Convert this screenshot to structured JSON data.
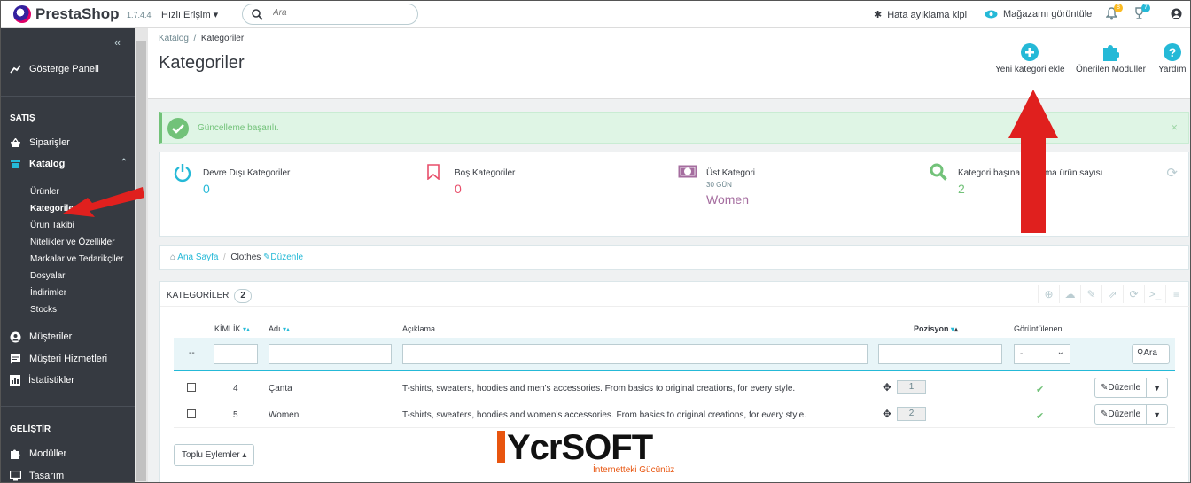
{
  "header": {
    "logo": "PrestaShop",
    "version": "1.7.4.4",
    "quick_access": "Hızlı Erişim",
    "search_placeholder": "Ara",
    "debug_mode": "Hata ayıklama kipi",
    "view_shop": "Mağazamı görüntüle",
    "notifications_count": "8",
    "trophy_count": "7"
  },
  "sidebar": {
    "dashboard": "Gösterge Paneli",
    "section_sell": "SATIŞ",
    "orders": "Siparişler",
    "catalog": "Katalog",
    "catalog_sub": [
      "Ürünler",
      "Kategoriler",
      "Ürün Takibi",
      "Nitelikler ve Özellikler",
      "Markalar ve Tedarikçiler",
      "Dosyalar",
      "İndirimler",
      "Stocks"
    ],
    "customers": "Müşteriler",
    "customer_service": "Müşteri Hizmetleri",
    "stats": "İstatistikler",
    "section_dev": "GELİŞTİR",
    "modules": "Modüller",
    "design": "Tasarım"
  },
  "page": {
    "breadcrumb_parent": "Katalog",
    "breadcrumb_sep": "/",
    "breadcrumb_current": "Kategoriler",
    "title": "Kategoriler",
    "toolbar": {
      "add": "Yeni kategori ekle",
      "modules": "Önerilen Modüller",
      "help": "Yardım"
    }
  },
  "alert": {
    "message": "Güncelleme başarılı.",
    "close": "×"
  },
  "kpis": [
    {
      "title": "Devre Dışı Kategoriler",
      "value": "0",
      "color": "#25b9d7"
    },
    {
      "title": "Boş Kategoriler",
      "value": "0",
      "color": "#e84e6a"
    },
    {
      "title": "Üst Kategori",
      "sub": "30 GÜN",
      "value": "Women",
      "color": "#a56d9f"
    },
    {
      "title": "Kategori başına ortalama ürün sayısı",
      "value": "2",
      "color": "#72c279"
    }
  ],
  "location": {
    "home": "Ana Sayfa",
    "sep": "/",
    "current": "Clothes",
    "edit": "Düzenle"
  },
  "table": {
    "title": "KATEGORİLER",
    "count": "2",
    "headers": {
      "id": "KİMLİK",
      "name": "Adı",
      "desc": "Açıklama",
      "position": "Pozisyon",
      "displayed": "Görüntülenen"
    },
    "filter_dash": "--",
    "filter_select": "-",
    "search_button": "Ara",
    "rows": [
      {
        "id": "4",
        "name": "Çanta",
        "desc": "T-shirts, sweaters, hoodies and men's accessories. From basics to original creations, for every style.",
        "position": "1",
        "edit": "Düzenle"
      },
      {
        "id": "5",
        "name": "Women",
        "desc": "T-shirts, sweaters, hoodies and women's accessories. From basics to original creations, for every style.",
        "position": "2",
        "edit": "Düzenle"
      }
    ],
    "bulk": "Toplu Eylemler"
  },
  "watermark": {
    "brand": "YcrSOFT",
    "tagline": "İnternetteki Gücünüz"
  }
}
